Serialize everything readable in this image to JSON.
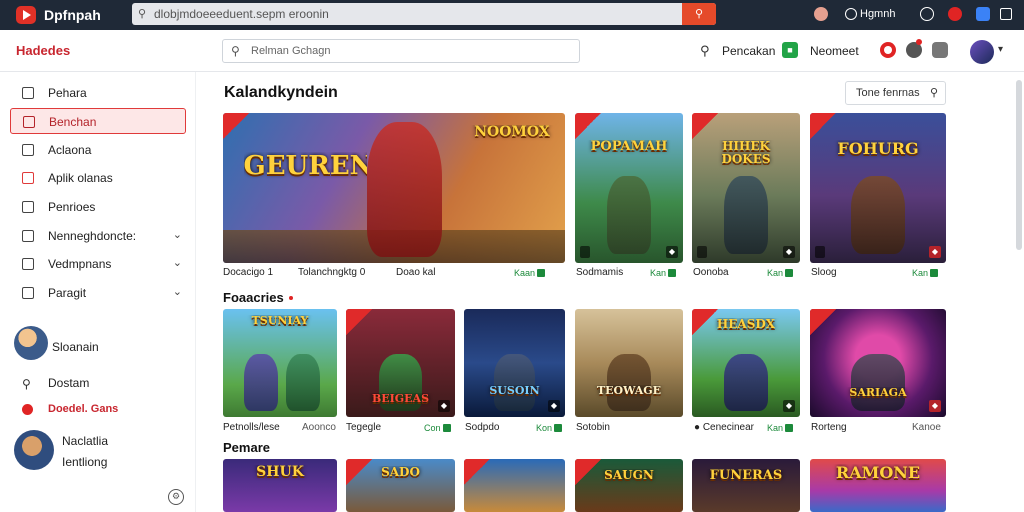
{
  "app": {
    "title": "Dpfnpah"
  },
  "topbar": {
    "address": "dlobjmdoeeeduent.sepm eroonin",
    "search_button_icon": "search-icon",
    "user_label": "Hgmnh"
  },
  "header": {
    "brand": "Hadedes",
    "search_placeholder": "Relman Gchagn",
    "link1": "Pencakan",
    "link2": "Neomeet",
    "green_badge": "■"
  },
  "sidebar": {
    "items": [
      {
        "label": "Pehara",
        "icon": "home-icon"
      },
      {
        "label": "Benchan",
        "icon": "grid-icon",
        "active": true
      },
      {
        "label": "Aclaona",
        "icon": "doc-icon"
      },
      {
        "label": "Aplik olanas",
        "icon": "box-icon",
        "red": true
      },
      {
        "label": "Penrioes",
        "icon": "book-icon"
      },
      {
        "label": "Nenneghdoncte:",
        "icon": "list-icon",
        "chevron": true
      },
      {
        "label": "Vedmpnans",
        "icon": "chat-icon",
        "chevron": true
      },
      {
        "label": "Paragit",
        "icon": "shield-icon",
        "chevron": true
      }
    ],
    "user1": "Sloanain",
    "extra1": "Dostam",
    "extra2": "Doedel. Gans",
    "user2_line1": "Naclatlia",
    "user2_line2": "Ientliong"
  },
  "main": {
    "section1_title": "Kalandkyndein",
    "filter_label": "Tone fenrnas",
    "section2_title": "Foaacries",
    "section3_title": "Pemare",
    "row1": [
      {
        "logo": "GEUREN",
        "caption": "Docacigo 1",
        "caption2": "Tolanchngktg 0",
        "caption3": "Doao kal",
        "right": "Kaan"
      },
      {
        "logo": "POPAMAH",
        "caption": "Sodmamis",
        "right": "Kan"
      },
      {
        "logo": "HIHEK DOKES",
        "caption": "Oonoba",
        "right": "Kan"
      },
      {
        "logo": "FOHURG",
        "caption": "Sloog",
        "right": "Kan"
      }
    ],
    "row2": [
      {
        "logo": "TSUNIAY",
        "caption": "Petnolls/lese",
        "caption_b": "Aoonco"
      },
      {
        "logo": "BEIGEAS",
        "caption": "Tegegle",
        "right": "Con"
      },
      {
        "logo": "SUSOIN",
        "caption": "Sodpdo",
        "right": "Kon"
      },
      {
        "logo": "TEOWAGE",
        "caption": "Sotobin"
      },
      {
        "logo": "HEASDX",
        "caption": "Cenecinear",
        "right": "Kan"
      },
      {
        "logo": "SARIAGA",
        "caption": "Rorteng",
        "caption_b": "Kanoe"
      }
    ],
    "row3": [
      {
        "logo": "SHUK"
      },
      {
        "logo": "SADO"
      },
      {
        "logo": ""
      },
      {
        "logo": "SAUGN"
      },
      {
        "logo": "FUNERAS"
      },
      {
        "logo": "RAMONE"
      }
    ]
  }
}
